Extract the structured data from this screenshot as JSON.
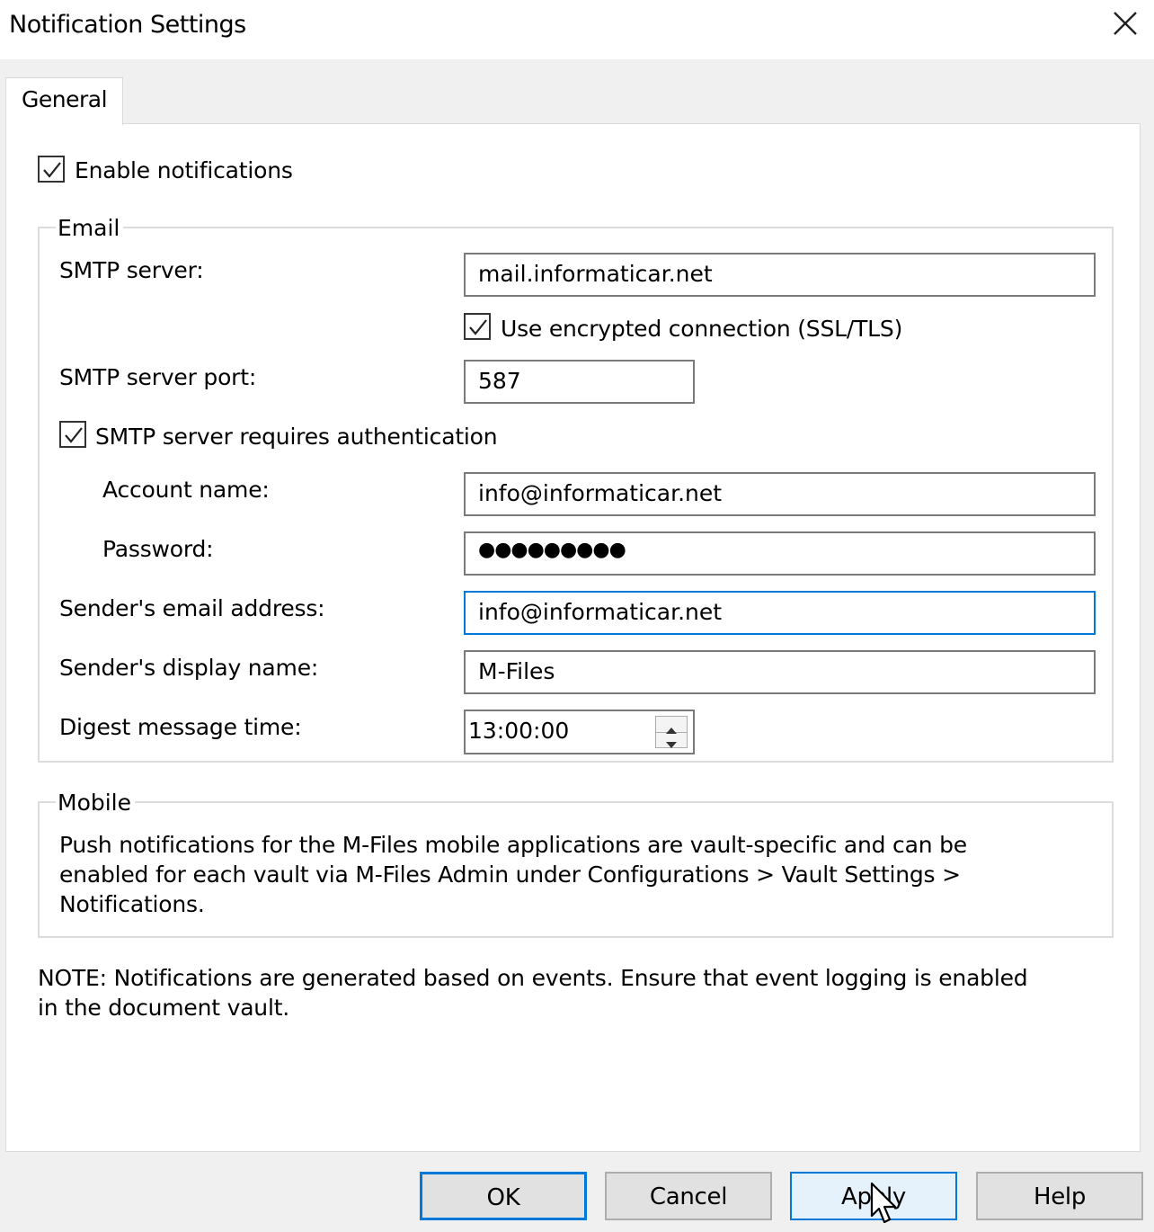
{
  "dialog": {
    "title": "Notification Settings",
    "close_icon": "close-icon"
  },
  "tabs": [
    {
      "label": "General",
      "selected": true
    }
  ],
  "enable_notifications": {
    "label": "Enable notifications",
    "checked": true
  },
  "email": {
    "group_label": "Email",
    "smtp_server": {
      "label": "SMTP server:",
      "value": "mail.informaticar.net"
    },
    "encrypted": {
      "label": "Use encrypted connection (SSL/TLS)",
      "checked": true
    },
    "smtp_port": {
      "label": "SMTP server port:",
      "value": "587"
    },
    "requires_auth": {
      "label": "SMTP server requires authentication",
      "checked": true
    },
    "account_name": {
      "label": "Account name:",
      "value": "info@informaticar.net"
    },
    "password": {
      "label": "Password:",
      "value": "●●●●●●●●●"
    },
    "sender_email": {
      "label": "Sender's email address:",
      "value": "info@informaticar.net"
    },
    "sender_display": {
      "label": "Sender's display name:",
      "value": "M-Files"
    },
    "digest_time": {
      "label": "Digest message time:",
      "value": "13:00:00"
    }
  },
  "mobile": {
    "group_label": "Mobile",
    "lines": [
      "Push notifications for the M-Files mobile applications are vault-specific and can be",
      "enabled for each vault via M-Files Admin under Configurations > Vault Settings >",
      "Notifications."
    ]
  },
  "note": {
    "lines": [
      "NOTE: Notifications are generated based on events. Ensure that event logging is enabled",
      "in the document vault."
    ]
  },
  "buttons": {
    "ok": "OK",
    "cancel": "Cancel",
    "apply": "Apply",
    "help": "Help"
  },
  "colors": {
    "accent": "#0078d7",
    "dialog_bg": "#f0f0f0",
    "panel_bg": "#ffffff",
    "button_bg": "#e1e1e1"
  }
}
